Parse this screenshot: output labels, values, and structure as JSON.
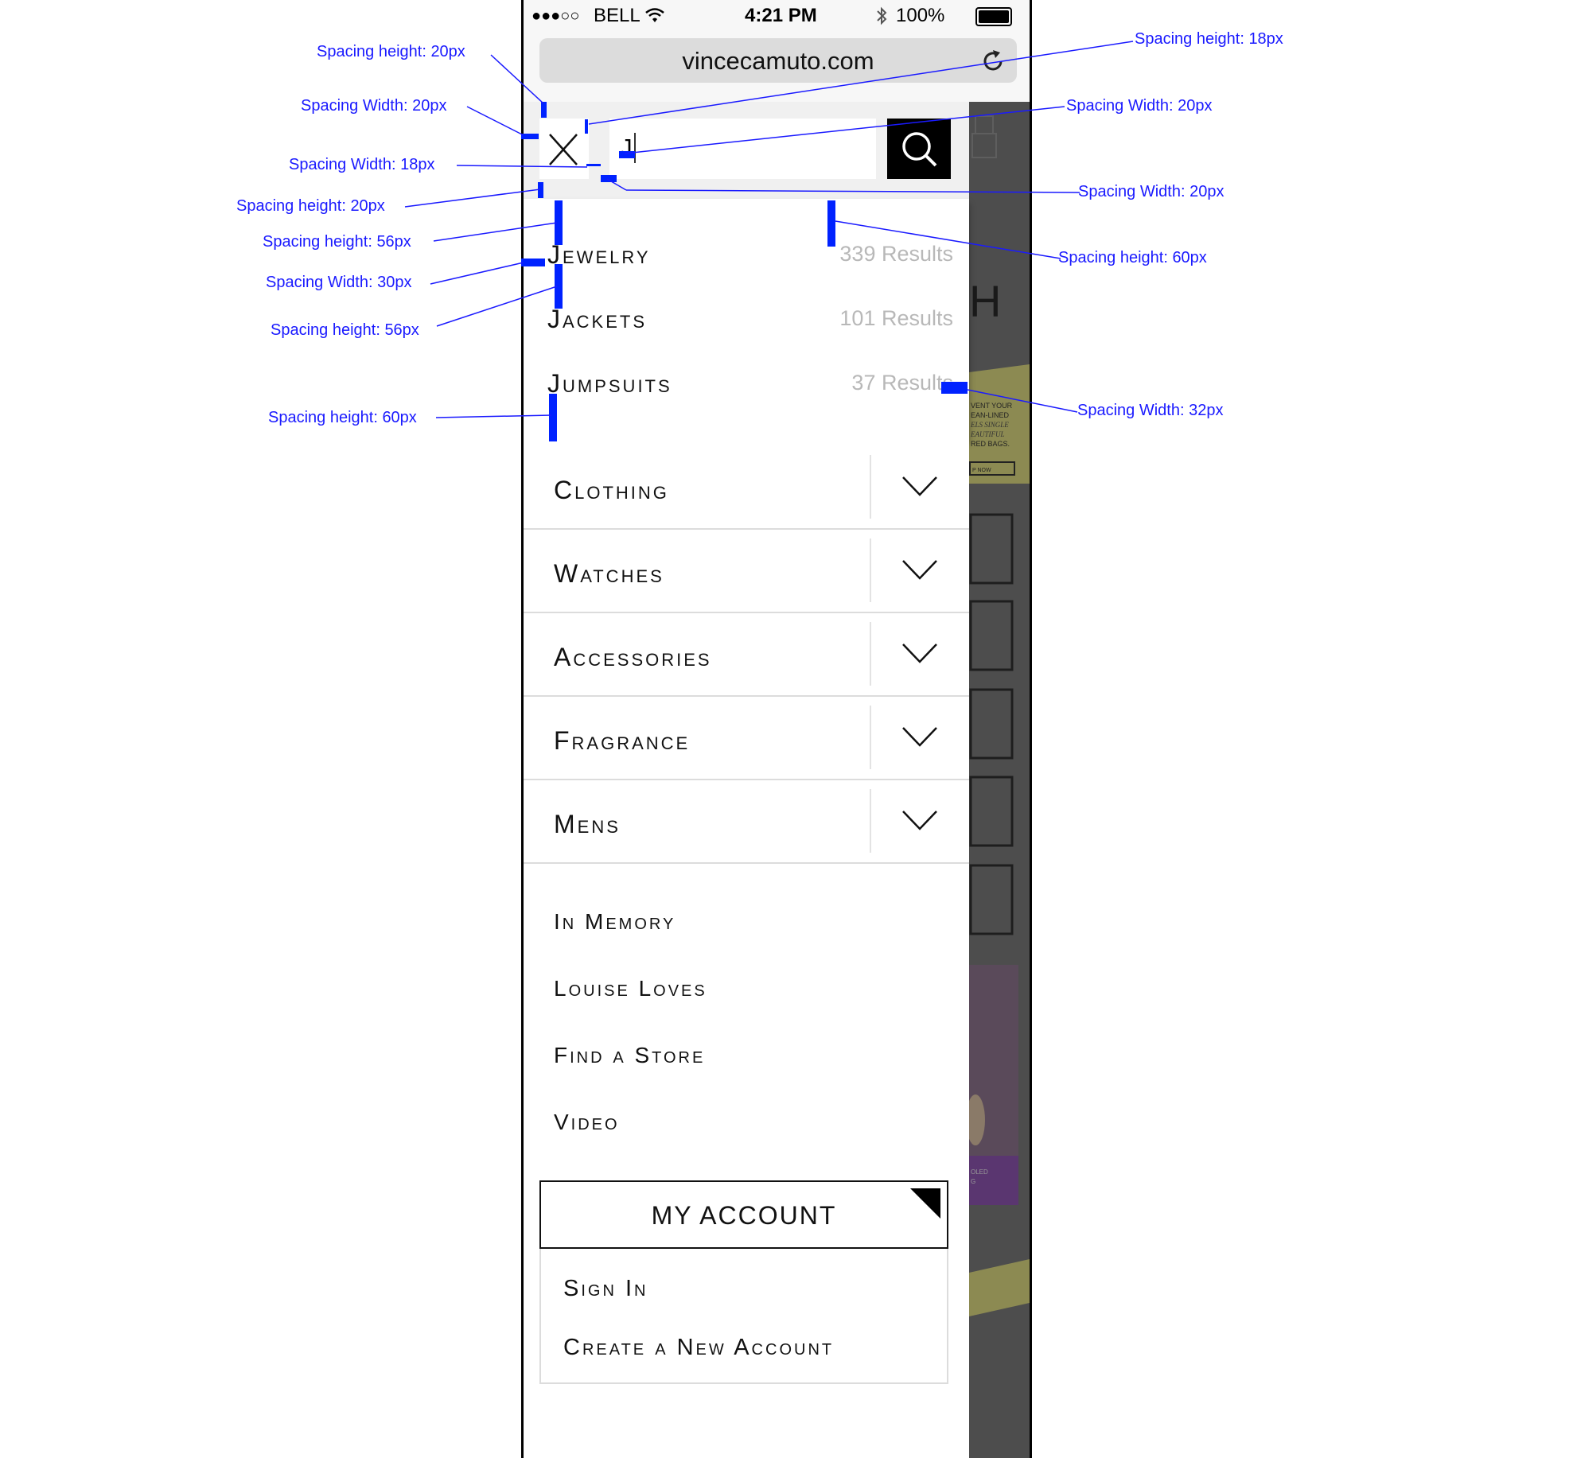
{
  "status_bar": {
    "carrier": "BELL",
    "signal": "●●●○○",
    "time": "4:21 PM",
    "battery": "100%"
  },
  "browser": {
    "url": "vincecamuto.com",
    "reload_icon": "reload-icon"
  },
  "search": {
    "query": "J",
    "close_icon": "close-icon",
    "search_icon": "search-icon"
  },
  "suggestions": [
    {
      "label": "Jewelry",
      "count": "339 Results"
    },
    {
      "label": "Jackets",
      "count": "101 Results"
    },
    {
      "label": "Jumpsuits",
      "count": "37 Results"
    }
  ],
  "categories": [
    {
      "label": "Clothing"
    },
    {
      "label": "Watches"
    },
    {
      "label": "Accessories"
    },
    {
      "label": "Fragrance"
    },
    {
      "label": "Mens"
    }
  ],
  "links": [
    "In Memory",
    "Louise Loves",
    "Find a Store",
    "Video"
  ],
  "account": {
    "title": "MY ACCOUNT",
    "sign_in": "Sign In",
    "create": "Create a New Account"
  },
  "annotations": [
    "Spacing height: 20px",
    "Spacing Width: 20px",
    "Spacing Width: 18px",
    "Spacing height: 20px",
    "Spacing height: 56px",
    "Spacing Width: 30px",
    "Spacing height: 56px",
    "Spacing height: 60px",
    "Spacing height: 18px",
    "Spacing Width: 20px",
    "Spacing Width: 20px",
    "Spacing height: 60px",
    "Spacing Width: 32px"
  ],
  "colors": {
    "annotation": "#0022ff",
    "accent": "#000000",
    "muted": "#b8b8b8"
  }
}
